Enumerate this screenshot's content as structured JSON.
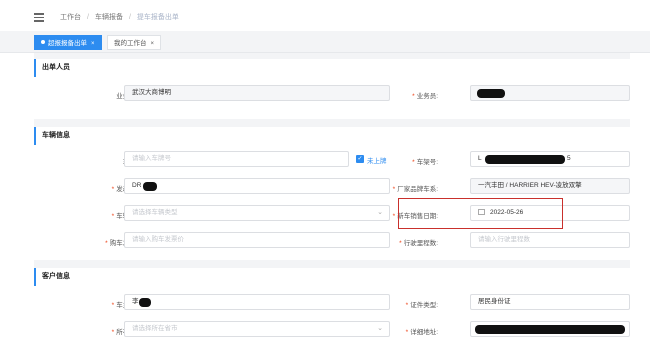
{
  "breadcrumb": {
    "item1": "工作台",
    "item2": "车辆报备",
    "item3": "提车报备出单"
  },
  "tabs": [
    {
      "label": "超报报备出单"
    },
    {
      "label": "我的工作台"
    }
  ],
  "close_glyph": "×",
  "sections": {
    "staff": {
      "title": "出单人员",
      "org_label": "业务机构:",
      "org_value": "武汉大商博明",
      "salesman_label": "业务员:"
    },
    "vehicle": {
      "title": "车辆信息",
      "plate_label": "车牌号:",
      "plate_placeholder": "请输入车牌号",
      "unregistered_label": "未上牌",
      "frame_label": "车架号:",
      "frame_prefix": "L",
      "frame_suffix": "5",
      "engine_label": "发动机号:",
      "engine_prefix": "DR",
      "brand_label": "厂家品牌车系:",
      "brand_value": "一汽丰田 / HARRIER HEV-凌放双擎",
      "vtype_label": "车辆类型:",
      "vtype_placeholder": "请选择车辆类型",
      "sale_date_label": "新车销售日期:",
      "sale_date_value": "2022-05-26",
      "invoice_label": "购车发票价:",
      "invoice_placeholder": "请输入购车发票价",
      "mileage_label": "行驶里程数:",
      "mileage_placeholder": "请输入行驶里程数"
    },
    "customer": {
      "title": "客户信息",
      "owner_label": "车主名称:",
      "owner_prefix": "李",
      "id_type_label": "证件类型:",
      "id_type_value": "居民身份证",
      "province_label": "所在省市:",
      "province_placeholder": "请选择所在省市",
      "address_label": "详细地址:"
    }
  },
  "colors": {
    "accent": "#2d8cf0",
    "highlight": "#c9302c",
    "required": "#ed4014"
  },
  "icons": [
    "menu-icon",
    "calendar-icon",
    "chevron-down-icon",
    "close-icon",
    "check-icon"
  ]
}
